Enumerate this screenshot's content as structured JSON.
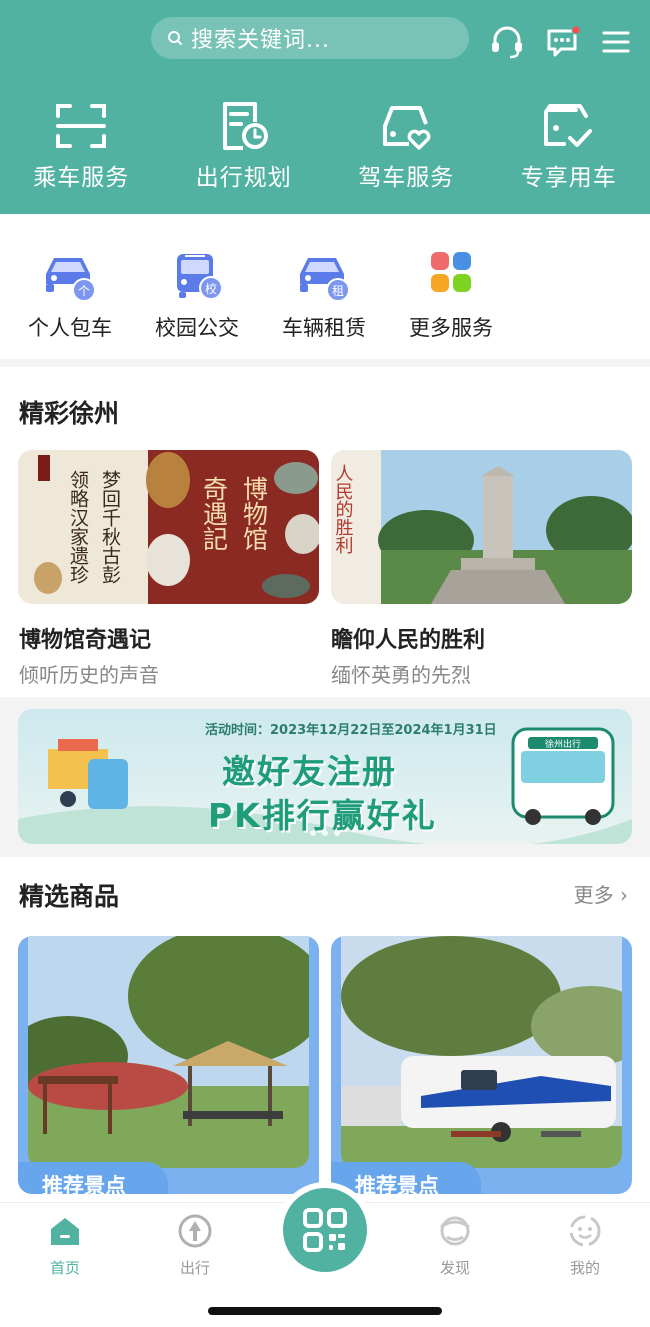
{
  "search": {
    "placeholder": "搜索关键词..."
  },
  "top_nav": [
    {
      "label": "乘车服务",
      "icon": "scan-frame-icon"
    },
    {
      "label": "出行规划",
      "icon": "schedule-doc-icon"
    },
    {
      "label": "驾车服务",
      "icon": "car-heart-icon"
    },
    {
      "label": "专享用车",
      "icon": "car-check-icon"
    }
  ],
  "services": [
    {
      "label": "个人包车",
      "icon": "car-private-icon",
      "badge": "个"
    },
    {
      "label": "校园公交",
      "icon": "school-bus-icon",
      "badge": "校"
    },
    {
      "label": "车辆租赁",
      "icon": "car-rental-icon",
      "badge": "租"
    },
    {
      "label": "更多服务",
      "icon": "grid-more-icon"
    }
  ],
  "xuzhou": {
    "title": "精彩徐州",
    "cards": [
      {
        "title": "博物馆奇遇记",
        "subtitle": "倾听历史的声音",
        "image_text": [
          "梦回千秋古彭",
          "领略汉家遗珍",
          "奇遇記",
          "博物馆"
        ]
      },
      {
        "title": "瞻仰人民的胜利",
        "subtitle": "缅怀英勇的先烈",
        "image_text": "人民的胜利"
      }
    ]
  },
  "banner": {
    "date": "活动时间：2023年12月22日至2024年1月31日",
    "line1": "邀好友注册",
    "line2": "PK排行赢好礼",
    "bus_sign": "徐州出行"
  },
  "goods": {
    "title": "精选商品",
    "more": "更多 ›",
    "items": [
      {
        "tag": "推荐景点"
      },
      {
        "tag": "推荐景点"
      }
    ]
  },
  "tabbar": [
    {
      "label": "首页",
      "active": true
    },
    {
      "label": "出行",
      "active": false
    },
    {
      "label": "发现",
      "active": false
    },
    {
      "label": "我的",
      "active": false
    }
  ],
  "colors": {
    "primary": "#52b2a2",
    "service_icon": "#5b7be8",
    "tag_blue": "#67a6ec"
  }
}
